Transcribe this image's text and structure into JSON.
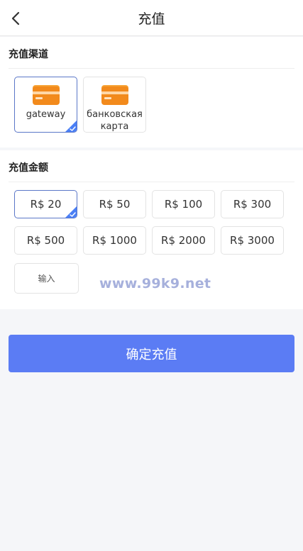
{
  "header": {
    "title": "充值",
    "back_icon": "chevron-left-icon"
  },
  "channels": {
    "title": "充值渠道",
    "items": [
      {
        "label": "gateway",
        "icon": "credit-card-icon",
        "selected": true
      },
      {
        "label": "банковская карта",
        "icon": "credit-card-icon",
        "selected": false
      }
    ]
  },
  "amounts": {
    "title": "充值金额",
    "items": [
      {
        "label": "R$ 20",
        "selected": true
      },
      {
        "label": "R$ 50",
        "selected": false
      },
      {
        "label": "R$ 100",
        "selected": false
      },
      {
        "label": "R$ 300",
        "selected": false
      },
      {
        "label": "R$ 500",
        "selected": false
      },
      {
        "label": "R$ 1000",
        "selected": false
      },
      {
        "label": "R$ 2000",
        "selected": false
      },
      {
        "label": "R$ 3000",
        "selected": false
      }
    ],
    "input_placeholder": "输入"
  },
  "watermark": "www.99k9.net",
  "confirm_label": "确定充值",
  "colors": {
    "accent": "#5b7cf4",
    "selected_border": "#5b77c8",
    "check_badge": "#4a7ff5",
    "card_icon": "#f28a1c"
  }
}
